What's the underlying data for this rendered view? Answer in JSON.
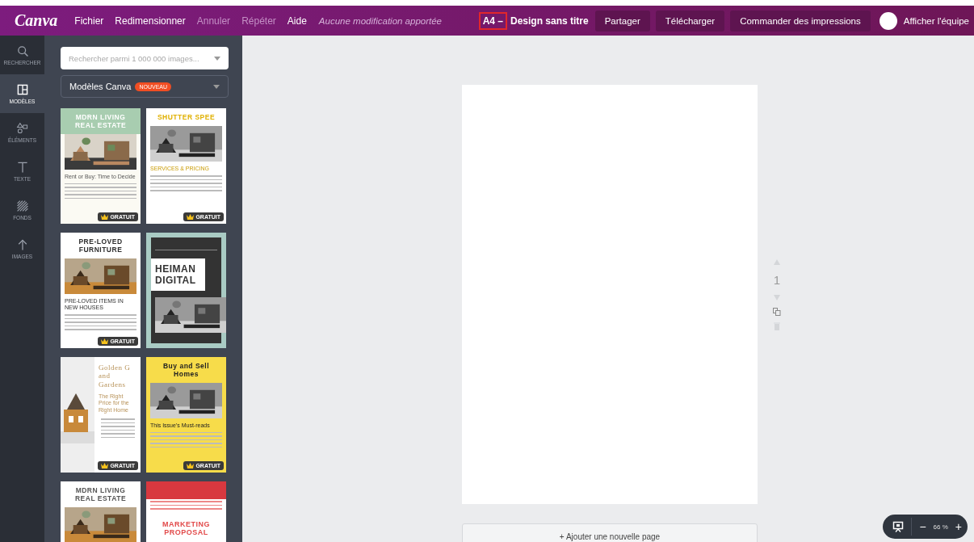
{
  "topbar": {
    "logo": "Canva",
    "menu": [
      {
        "label": "Fichier",
        "disabled": false
      },
      {
        "label": "Redimensionner",
        "disabled": false
      },
      {
        "label": "Annuler",
        "disabled": true
      },
      {
        "label": "Répéter",
        "disabled": true
      },
      {
        "label": "Aide",
        "disabled": false
      }
    ],
    "status": "Aucune modification apportée",
    "document": {
      "size": "A4 –",
      "highlighted": true,
      "title": "Design sans titre"
    },
    "buttons": [
      "Partager",
      "Télécharger",
      "Commander des impressions"
    ],
    "team": "Afficher l'équipe"
  },
  "rail": [
    {
      "kind": "search",
      "label": "RECHERCHER",
      "selected": false
    },
    {
      "kind": "templates",
      "label": "MODÈLES",
      "selected": true
    },
    {
      "kind": "elements",
      "label": "ÉLÉMENTS",
      "selected": false
    },
    {
      "kind": "text",
      "label": "TEXTE",
      "selected": false
    },
    {
      "kind": "backgrounds",
      "label": "FONDS",
      "selected": false
    },
    {
      "kind": "upload",
      "label": "IMAGES",
      "selected": false
    }
  ],
  "panel": {
    "search": {
      "placeholder": "Rechercher parmi 1 000 000 images..."
    },
    "category": {
      "label": "Modèles Canva",
      "badge": "NOUVEAU"
    },
    "templates": [
      {
        "kind": "green",
        "heading": "MDRN LIVING REAL ESTATE",
        "subheading": "Rent or Buy: Time to Decide",
        "badge": "GRATUIT"
      },
      {
        "kind": "yellow",
        "heading": "SHUTTER SPEE",
        "subheading": "SERVICES & PRICING",
        "badge": "GRATUIT"
      },
      {
        "kind": "white",
        "heading": "PRE-LOVED FURNITURE",
        "subheading": "PRE-LOVED ITEMS IN NEW HOUSES",
        "badge": "GRATUIT"
      },
      {
        "kind": "dark",
        "heading": "HEIMAN DIGITAL"
      },
      {
        "kind": "side",
        "heading": "Golden G and Gardens",
        "subheading": "The Right Price for the Right Home",
        "badge": "GRATUIT"
      },
      {
        "kind": "yellow-photo",
        "heading": "Buy and Sell Homes",
        "subheading": "This Issue's Must-reads",
        "badge": "GRATUIT"
      },
      {
        "kind": "white-header",
        "heading": "MDRN LIVING REAL ESTATE"
      },
      {
        "kind": "red",
        "heading": "MARKETING PROPOSAL"
      }
    ]
  },
  "page_tools": {
    "page_number": "1"
  },
  "add_page": "+ Ajouter une nouvelle page",
  "zoom": {
    "minus": "−",
    "value": "66 %",
    "plus": "+"
  }
}
